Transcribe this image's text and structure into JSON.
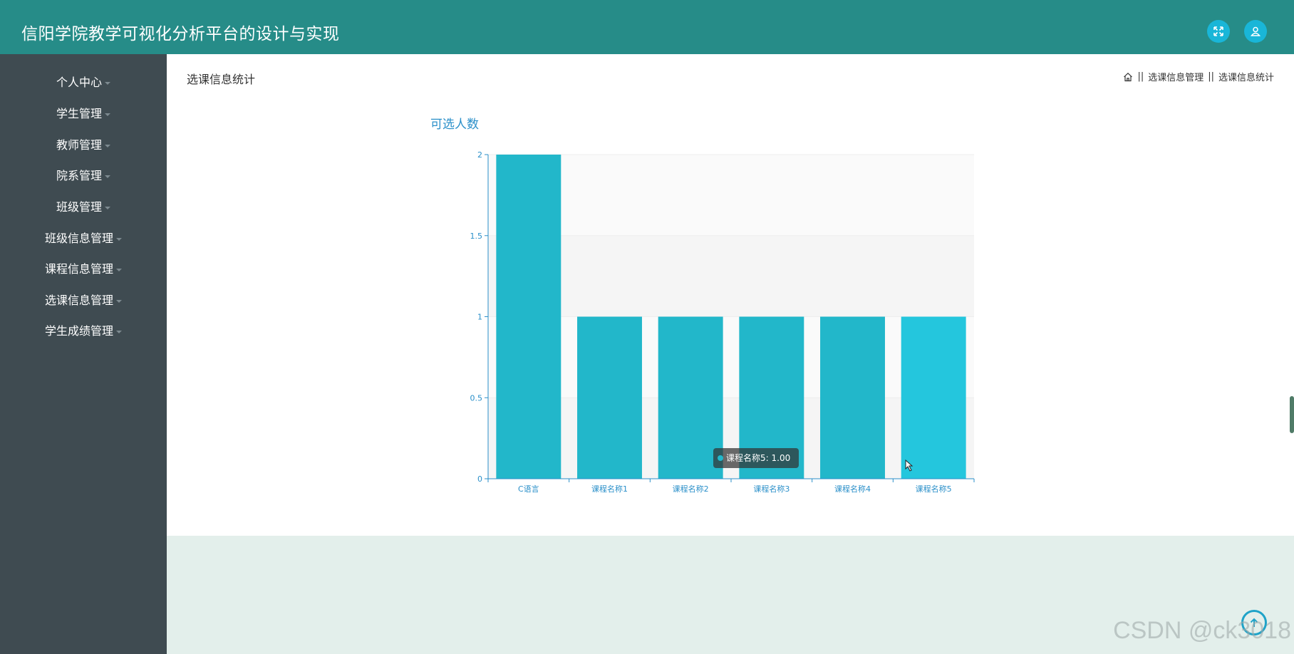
{
  "app": {
    "title": "信阳学院教学可视化分析平台的设计与实现"
  },
  "header": {
    "fullscreen_icon": "fullscreen-icon",
    "user_icon": "user-icon"
  },
  "sidebar": {
    "items": [
      {
        "label": "个人中心"
      },
      {
        "label": "学生管理"
      },
      {
        "label": "教师管理"
      },
      {
        "label": "院系管理"
      },
      {
        "label": "班级管理"
      },
      {
        "label": "班级信息管理"
      },
      {
        "label": "课程信息管理"
      },
      {
        "label": "选课信息管理"
      },
      {
        "label": "学生成绩管理"
      }
    ]
  },
  "page": {
    "title": "选课信息统计",
    "breadcrumb": {
      "sep": "||",
      "level1": "选课信息管理",
      "level2": "选课信息统计"
    }
  },
  "tooltip": {
    "text": "课程名称5: 1.00"
  },
  "watermark": "CSDN @ck3018",
  "colors": {
    "header": "#268c88",
    "sidebar": "#3f4b51",
    "bar": "#22b7ca",
    "bar_hover": "#24c6dd",
    "axis": "#2a8fc9"
  },
  "chart_data": {
    "type": "bar",
    "title": "可选人数",
    "categories": [
      "C语言",
      "课程名称1",
      "课程名称2",
      "课程名称3",
      "课程名称4",
      "课程名称5"
    ],
    "values": [
      2,
      1,
      1,
      1,
      1,
      1
    ],
    "ylim": [
      0,
      2
    ],
    "yticks": [
      0,
      0.5,
      1,
      1.5,
      2
    ],
    "ytick_labels": [
      "0",
      "0.5",
      "1",
      "1.5",
      "2"
    ],
    "xlabel": "",
    "ylabel": "",
    "grid": true
  }
}
